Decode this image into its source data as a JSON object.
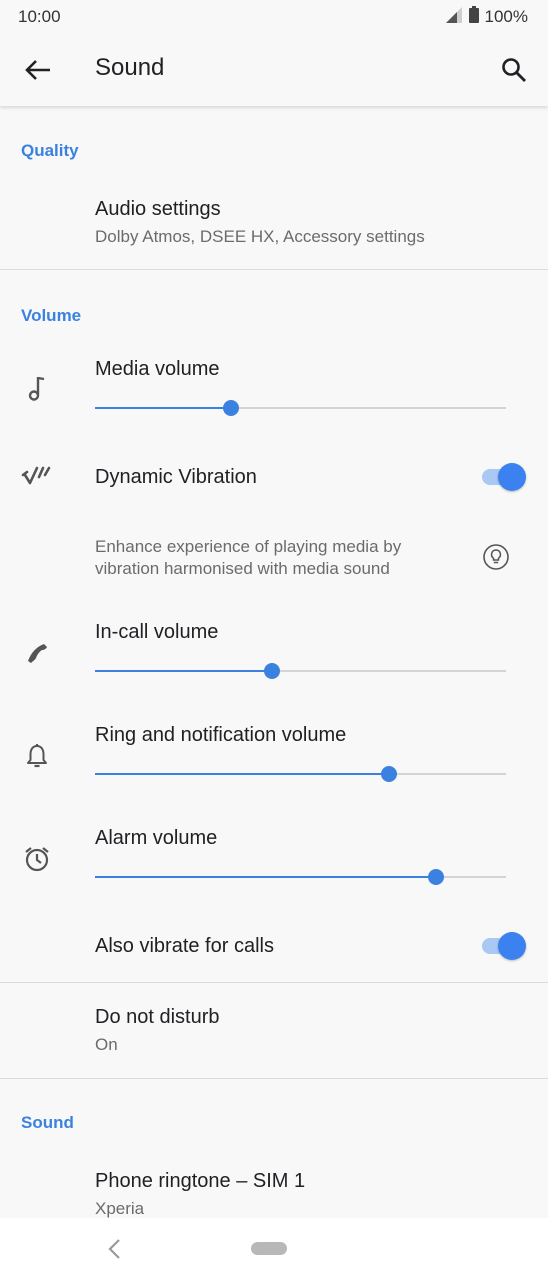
{
  "status_bar": {
    "time": "10:00",
    "battery": "100%"
  },
  "app_bar": {
    "title": "Sound"
  },
  "sections": {
    "quality": "Quality",
    "volume": "Volume",
    "sound": "Sound"
  },
  "audio_settings": {
    "title": "Audio settings",
    "subtitle": "Dolby Atmos, DSEE HX, Accessory settings"
  },
  "media_volume": {
    "title": "Media volume",
    "level": 0.33
  },
  "dynamic_vibration": {
    "title": "Dynamic Vibration",
    "enabled": true,
    "description": "Enhance experience of playing media by vibration harmonised with media sound"
  },
  "in_call_volume": {
    "title": "In-call volume",
    "level": 0.43
  },
  "ring_volume": {
    "title": "Ring and notification volume",
    "level": 0.715
  },
  "alarm_volume": {
    "title": "Alarm volume",
    "level": 0.83
  },
  "also_vibrate": {
    "title": "Also vibrate for calls",
    "enabled": true
  },
  "do_not_disturb": {
    "title": "Do not disturb",
    "subtitle": "On"
  },
  "phone_ringtone": {
    "title": "Phone ringtone – SIM 1",
    "subtitle": "Xperia"
  },
  "colors": {
    "accent": "#3b82e0",
    "toggle_knob": "#3b82f0",
    "toggle_track": "#a9c8f3"
  }
}
